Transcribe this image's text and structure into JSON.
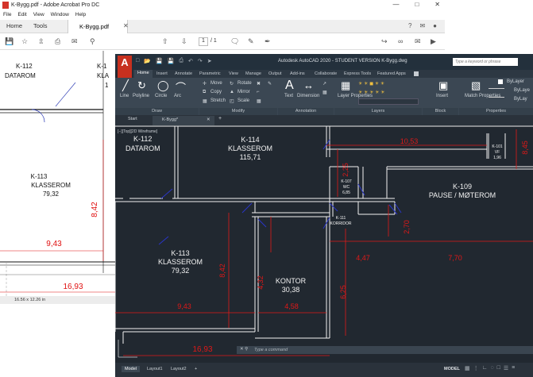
{
  "acrobat": {
    "title": "K-Bygg.pdf - Adobe Acrobat Pro DC",
    "menu": [
      "File",
      "Edit",
      "View",
      "Window",
      "Help"
    ],
    "tabs": {
      "home": "Home",
      "tools": "Tools",
      "document": "K-Bygg.pdf"
    },
    "toolbar": {
      "page_current": "1",
      "page_total": "/ 1"
    },
    "status_size": "16.56 x 12.26 in",
    "plan": {
      "room_k112": {
        "id": "K-112",
        "name": "DATAROM"
      },
      "room_k113": {
        "id": "K-113",
        "name": "KLASSEROM",
        "area": "79,32"
      },
      "room_k114_partial": {
        "id": "K-1",
        "name": "KLA",
        "area": "1"
      },
      "dim_842": "8,42",
      "dim_943": "9,43",
      "dim_1693": "16,93"
    }
  },
  "autocad": {
    "title": "Autodesk AutoCAD 2020 - STUDENT VERSION    K-Bygg.dwg",
    "search_placeholder": "Type a keyword or phrase",
    "logo_letter": "A",
    "ribbon_tabs": [
      "Home",
      "Insert",
      "Annotate",
      "Parametric",
      "View",
      "Manage",
      "Output",
      "Add-ins",
      "Collaborate",
      "Express Tools",
      "Featured Apps"
    ],
    "draw_tools": [
      "Line",
      "Polyline",
      "Circle",
      "Arc"
    ],
    "modify_tools": [
      "Move",
      "Rotate",
      "Copy",
      "Mirror",
      "Stretch",
      "Scale"
    ],
    "annotation_tools": [
      "Text",
      "Dimension"
    ],
    "layer_tools": [
      "Layer Properties"
    ],
    "block_tools": [
      "Insert"
    ],
    "property_tools": [
      "Match Properties"
    ],
    "bylayer": [
      "ByLayer",
      "ByLaye",
      "ByLay"
    ],
    "panels": {
      "draw": "Draw",
      "modify": "Modify",
      "annotation": "Annotation",
      "layers": "Layers",
      "block": "Block",
      "properties": "Properties"
    },
    "file_tabs": {
      "start": "Start",
      "current": "K-Bygg*"
    },
    "view_label": "[−][Top][2D Wireframe]",
    "command_placeholder": "Type a command",
    "layout_tabs": [
      "Model",
      "Layout1",
      "Layout2"
    ],
    "status_model": "MODEL",
    "plan": {
      "room_k112": {
        "id": "K-112",
        "name": "DATAROM"
      },
      "room_k114": {
        "id": "K-114",
        "name": "KLASSEROM",
        "area": "115,71"
      },
      "room_k113": {
        "id": "K-113",
        "name": "KLASSEROM",
        "area": "79,32"
      },
      "room_kontor": {
        "name": "KONTOR",
        "area": "30,38"
      },
      "room_k109": {
        "id": "K-109",
        "name": "PAUSE / MØTEROM"
      },
      "room_k107": {
        "id": "K-107",
        "name": "WC",
        "area": "6,85"
      },
      "room_k101": {
        "id": "K-101",
        "name": "VF",
        "area": "1,96"
      },
      "room_k111": {
        "id": "K-111",
        "name": "KORRIDOR"
      },
      "dims": {
        "d1053": "10,53",
        "d845": "8,45",
        "d225": "2,25",
        "d270": "2,70",
        "d447": "4,47",
        "d770": "7,70",
        "d842": "8,42",
        "d432": "4,32",
        "d625": "6,25",
        "d943": "9,43",
        "d458": "4,58",
        "d1693": "16,93"
      }
    }
  }
}
